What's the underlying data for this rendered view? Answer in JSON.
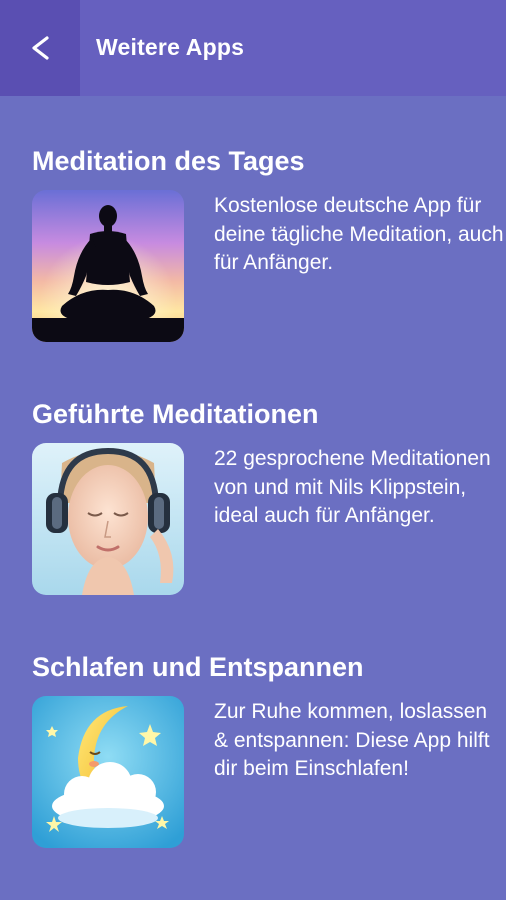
{
  "header": {
    "back_icon": "chevron-left-icon",
    "title": "Weitere Apps"
  },
  "apps": [
    {
      "title": "Meditation des Tages",
      "icon": "meditation-silhouette-icon",
      "description": "Kostenlose deutsche App für deine tägliche Meditation, auch für Anfänger."
    },
    {
      "title": "Geführte Meditationen",
      "icon": "woman-headphones-icon",
      "description": "22 gesprochene Meditationen von und mit Nils Klippstein, ideal auch für Anfänger."
    },
    {
      "title": "Schlafen und Entspannen",
      "icon": "sleeping-moon-icon",
      "description": "Zur Ruhe kommen, loslassen & entspannen: Diese App hilft dir beim Einschlafen!"
    }
  ],
  "colors": {
    "background": "#6b6fc2",
    "topbar": "#6660bf",
    "back_button": "#5a4fb2",
    "text": "#ffffff"
  }
}
